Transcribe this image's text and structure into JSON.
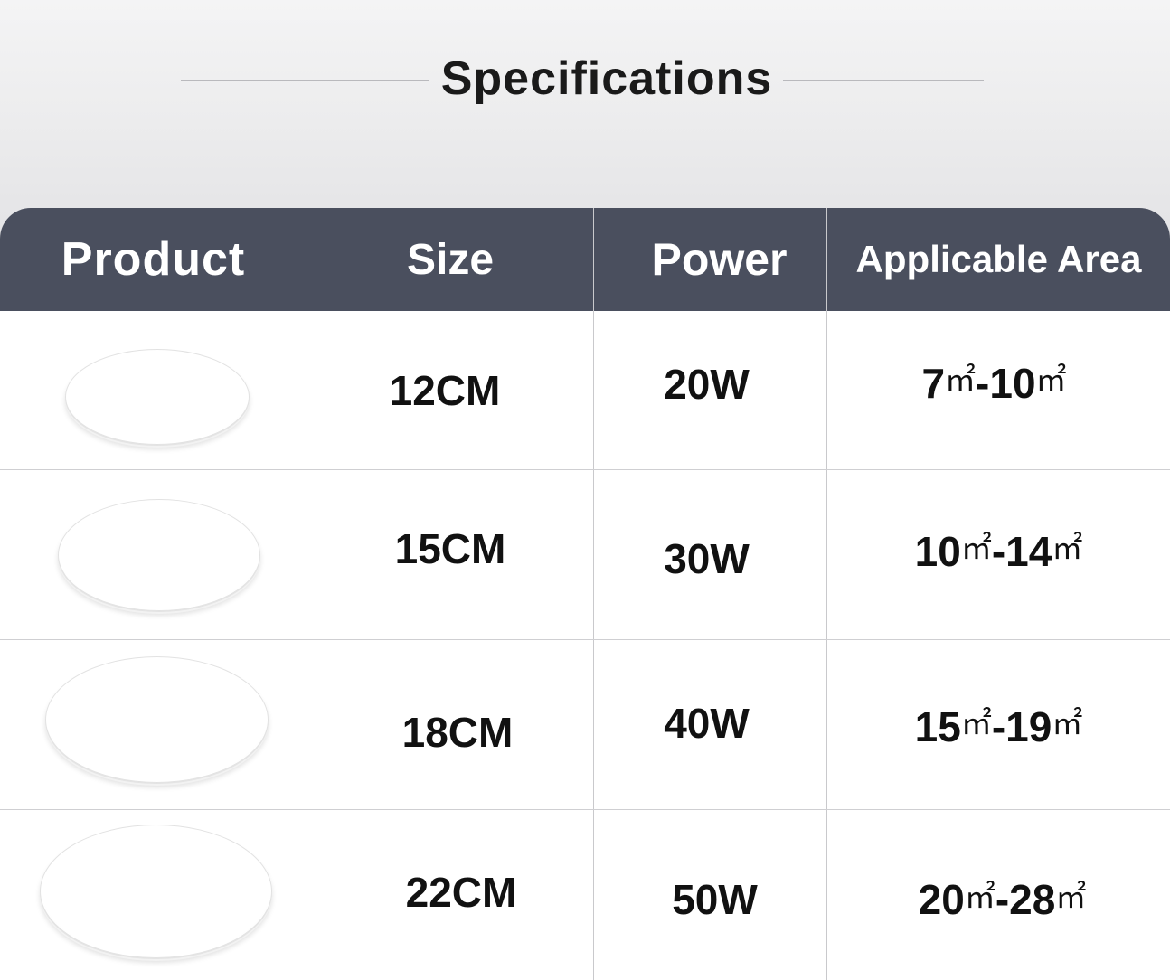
{
  "title": "Specifications",
  "table": {
    "headers": [
      "Product",
      "Size",
      "Power",
      "Applicable Area"
    ],
    "rows": [
      {
        "size": "12CM",
        "power": "20W",
        "area_from": "7",
        "area_to": "10",
        "unit": "㎡"
      },
      {
        "size": "15CM",
        "power": "30W",
        "area_from": "10",
        "area_to": "14",
        "unit": "㎡"
      },
      {
        "size": "18CM",
        "power": "40W",
        "area_from": "15",
        "area_to": "19",
        "unit": "㎡"
      },
      {
        "size": "22CM",
        "power": "50W",
        "area_from": "20",
        "area_to": "28",
        "unit": "㎡"
      }
    ],
    "header_bg": "#4a4f5e"
  }
}
